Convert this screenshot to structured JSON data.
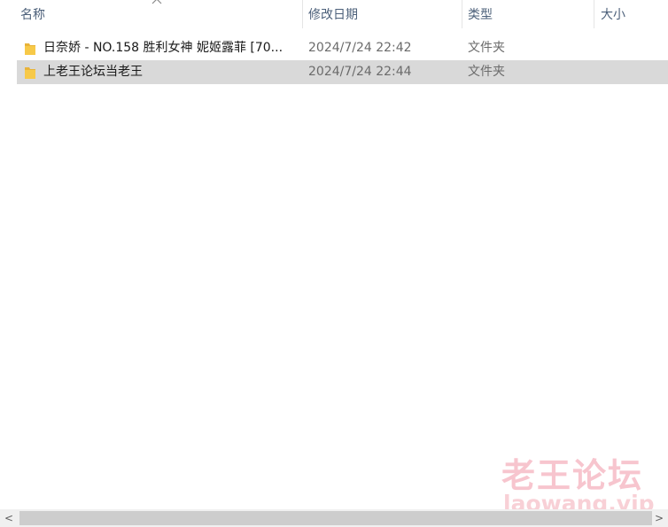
{
  "columns": {
    "name": "名称",
    "date": "修改日期",
    "type": "类型",
    "size": "大小"
  },
  "sort": {
    "column": "name",
    "direction": "ascending"
  },
  "rows": [
    {
      "name": "日奈娇 - NO.158 胜利女神 妮姬露菲 [70...",
      "date": "2024/7/24 22:42",
      "type": "文件夹",
      "icon": "folder-icon",
      "selected": false
    },
    {
      "name": "上老王论坛当老王",
      "date": "2024/7/24 22:44",
      "type": "文件夹",
      "icon": "folder-icon",
      "selected": true
    }
  ],
  "watermark": {
    "title": "老王论坛",
    "site": "laowang.vip"
  },
  "scrollbar": {
    "left_arrow": "<",
    "right_arrow": ">"
  },
  "colors": {
    "header_text": "#4c607a",
    "selected_row": "#d9d9d9",
    "folder": "#f5c242",
    "watermark": "#f096a5"
  }
}
